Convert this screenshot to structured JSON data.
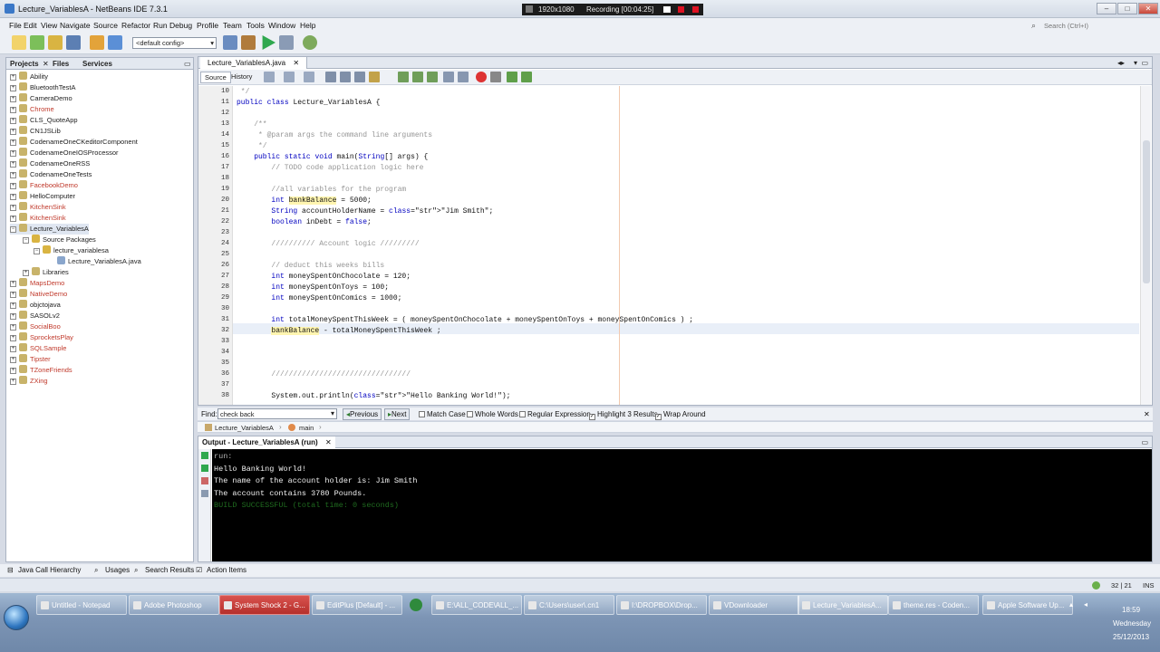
{
  "window": {
    "title": "Lecture_VariablesA - NetBeans IDE 7.3.1"
  },
  "recording": {
    "resolution": "1920x1080",
    "status": "Recording [00:04:25]"
  },
  "menu": [
    "File",
    "Edit",
    "View",
    "Navigate",
    "Source",
    "Refactor",
    "Run",
    "Debug",
    "Profile",
    "Team",
    "Tools",
    "Window",
    "Help"
  ],
  "search": {
    "placeholder": "Search (Ctrl+I)"
  },
  "toolbar": {
    "config": "<default config>"
  },
  "left_panel": {
    "tabs": [
      "Projects",
      "Files",
      "Services"
    ],
    "projects": [
      {
        "label": "Ability",
        "color": "dark"
      },
      {
        "label": "BluetoothTestA",
        "color": "dark"
      },
      {
        "label": "CameraDemo",
        "color": "dark"
      },
      {
        "label": "Chrome",
        "color": "red"
      },
      {
        "label": "CLS_QuoteApp",
        "color": "dark"
      },
      {
        "label": "CN1JSLib",
        "color": "dark"
      },
      {
        "label": "CodenameOneCKeditorComponent",
        "color": "dark"
      },
      {
        "label": "CodenameOneIOSProcessor",
        "color": "dark"
      },
      {
        "label": "CodenameOneRSS",
        "color": "dark"
      },
      {
        "label": "CodenameOneTests",
        "color": "dark"
      },
      {
        "label": "FacebookDemo",
        "color": "red"
      },
      {
        "label": "HelloComputer",
        "color": "dark"
      },
      {
        "label": "KitchenSink",
        "color": "red"
      },
      {
        "label": "KitchenSink",
        "color": "red"
      },
      {
        "label": "Lecture_VariablesA",
        "color": "dark"
      },
      {
        "label": "Source Packages",
        "color": "dark"
      },
      {
        "label": "lecture_variablesa",
        "color": "dark"
      },
      {
        "label": "Lecture_VariablesA.java",
        "color": "dark"
      },
      {
        "label": "Libraries",
        "color": "dark"
      },
      {
        "label": "MapsDemo",
        "color": "red"
      },
      {
        "label": "NativeDemo",
        "color": "red"
      },
      {
        "label": "objctojava",
        "color": "dark"
      },
      {
        "label": "SASOLv2",
        "color": "dark"
      },
      {
        "label": "SocialBoo",
        "color": "red"
      },
      {
        "label": "SprocketsPlay",
        "color": "red"
      },
      {
        "label": "SQLSample",
        "color": "red"
      },
      {
        "label": "Tipster",
        "color": "red"
      },
      {
        "label": "TZoneFriends",
        "color": "red"
      },
      {
        "label": "ZXing",
        "color": "red"
      }
    ]
  },
  "editor": {
    "tab": "Lecture_VariablesA.java",
    "source_label": "Source",
    "history_label": "History",
    "line_numbers": [
      "10",
      "11",
      "12",
      "13",
      "14",
      "15",
      "16",
      "17",
      "18",
      "19",
      "20",
      "21",
      "22",
      "23",
      "24",
      "25",
      "26",
      "27",
      "28",
      "29",
      "30",
      "31",
      "32",
      "33",
      "34",
      "35",
      "36",
      "37",
      "38"
    ],
    "lines": [
      " */",
      "public class Lecture_VariablesA {",
      "",
      "    /**",
      "     * @param args the command line arguments",
      "     */",
      "    public static void main(String[] args) {",
      "        // TODO code application logic here",
      "",
      "        //all variables for the program",
      "        int bankBalance = 5000;",
      "        String accountHolderName = \"Jim Smith\";",
      "        boolean inDebt = false;",
      "",
      "        ////////// Account logic /////////",
      "",
      "        // deduct this weeks bills",
      "        int moneySpentOnChocolate = 120;",
      "        int moneySpentOnToys = 100;",
      "        int moneySpentOnComics = 1000;",
      "",
      "        int totalMoneySpentThisWeek = ( moneySpentOnChocolate + moneySpentOnToys + moneySpentOnComics ) ;",
      "        bankBalance - totalMoneySpentThisWeek ;",
      "",
      "",
      "",
      "        ////////////////////////////////",
      "",
      "        System.out.println(\"Hello Banking World!\");"
    ]
  },
  "find": {
    "label": "Find:",
    "value": "check back",
    "previous": "Previous",
    "next": "Next",
    "match_case": "Match Case",
    "whole_words": "Whole Words",
    "regex": "Regular Expression",
    "highlight": "Highlight 3 Results",
    "wrap": "Wrap Around"
  },
  "breadcrumb": [
    "Lecture_VariablesA",
    "main"
  ],
  "output": {
    "tab": "Output - Lecture_VariablesA (run)",
    "lines": [
      "run:",
      "Hello Banking World!",
      "The name of the account holder is: Jim Smith",
      "The account contains 3780 Pounds.",
      "BUILD SUCCESSFUL (total time: 0 seconds)"
    ]
  },
  "bottom_tools": [
    "Java Call Hierarchy",
    "Usages",
    "Search Results",
    "Action Items"
  ],
  "status": {
    "position": "32 | 21",
    "mode": "INS"
  },
  "taskbar": {
    "tasks": [
      {
        "label": "Untitled - Notepad",
        "style": "normal"
      },
      {
        "label": "Adobe Photoshop",
        "style": "normal"
      },
      {
        "label": "System Shock 2 - G...",
        "style": "red"
      },
      {
        "label": "EditPlus [Default] - ...",
        "style": "normal"
      },
      {
        "label": "E:\\ALL_CODE\\ALL_...",
        "style": "normal"
      },
      {
        "label": "C:\\Users\\user\\.cn1",
        "style": "normal"
      },
      {
        "label": "I:\\DROPBOX\\Drop...",
        "style": "normal"
      },
      {
        "label": "VDownloader",
        "style": "normal"
      },
      {
        "label": "Lecture_VariablesA...",
        "style": "active"
      },
      {
        "label": "theme.res - Coden...",
        "style": "normal"
      },
      {
        "label": "Apple Software Up...",
        "style": "normal"
      }
    ],
    "clock": {
      "time": "18:59",
      "day": "Wednesday",
      "date": "25/12/2013"
    }
  },
  "colors": {
    "accent": "#3b78c7",
    "output_bg": "#000000",
    "build_ok": "#1f6b1f"
  }
}
